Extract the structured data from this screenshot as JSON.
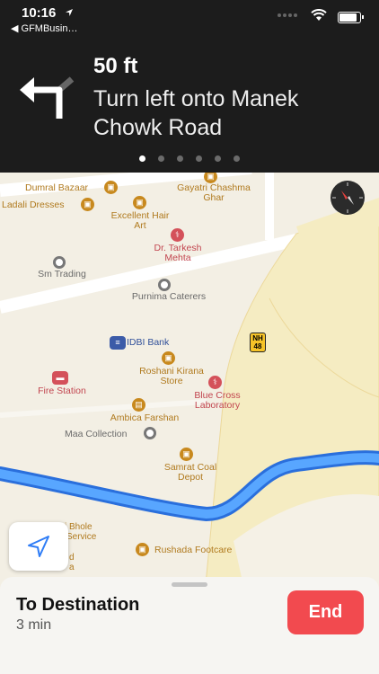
{
  "status_bar": {
    "time": "10:16",
    "back_label": "◀ GFMBusin…"
  },
  "nav_banner": {
    "distance": "50 ft",
    "instruction": "Turn left onto Manek Chowk Road",
    "pages": 6,
    "active_page": 0
  },
  "map": {
    "pois": [
      {
        "name": "Dumral Bazaar",
        "icon": "shopping-bag-icon",
        "color": "#c8891e"
      },
      {
        "name": "Gayatri Chashma Ghar",
        "icon": "shopping-bag-icon",
        "color": "#c8891e"
      },
      {
        "name": "Ladali Dresses",
        "icon": "shopping-bag-icon",
        "color": "#c8891e"
      },
      {
        "name": "Excellent Hair Art",
        "icon": "shopping-bag-icon",
        "color": "#c8891e"
      },
      {
        "name": "Dr. Tarkesh Mehta",
        "icon": "stethoscope-icon",
        "color": "#d4515a"
      },
      {
        "name": "Sm Trading",
        "icon": "dot-icon",
        "color": "#777777"
      },
      {
        "name": "Purnima Caterers",
        "icon": "dot-icon",
        "color": "#777777"
      },
      {
        "name": "IDBI Bank",
        "icon": "bank-icon",
        "color": "#3b5ba8"
      },
      {
        "name": "Roshani Kirana Store",
        "icon": "shopping-bag-icon",
        "color": "#c8891e"
      },
      {
        "name": "Fire Station",
        "icon": "fire-truck-icon",
        "color": "#d4515a"
      },
      {
        "name": "Blue Cross Laboratory",
        "icon": "stethoscope-icon",
        "color": "#d4515a"
      },
      {
        "name": "Ambica Farshan",
        "icon": "cart-icon",
        "color": "#c8891e"
      },
      {
        "name": "Maa Collection",
        "icon": "dot-icon",
        "color": "#777777"
      },
      {
        "name": "Samrat Coal Depot",
        "icon": "shopping-bag-icon",
        "color": "#c8891e"
      },
      {
        "name": "Rushada Footcare",
        "icon": "shopping-bag-icon",
        "color": "#c8891e"
      }
    ],
    "partial_labels": [
      "i Bhole",
      "Service",
      "d",
      "a"
    ],
    "highway_shield": {
      "line1": "NH",
      "line2": "48"
    },
    "route_color": "#3a82f7"
  },
  "bottom_sheet": {
    "title": "To Destination",
    "eta": "3 min",
    "end_label": "End"
  }
}
